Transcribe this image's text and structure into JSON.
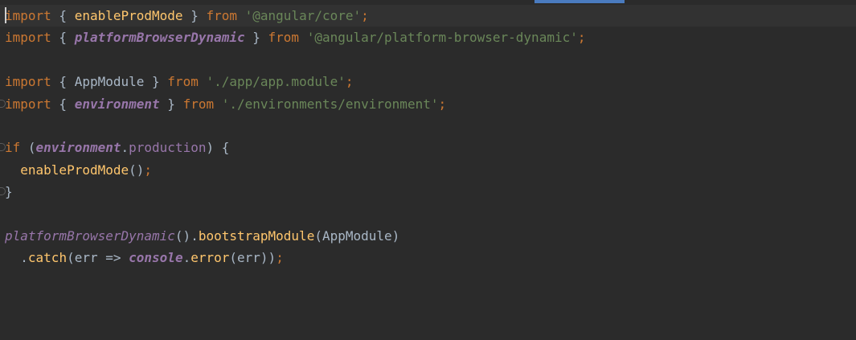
{
  "editor": {
    "lines": [
      [
        {
          "t": "import",
          "c": "kw"
        },
        {
          "t": " { ",
          "c": "plain"
        },
        {
          "t": "enableProdMode",
          "c": "fn"
        },
        {
          "t": " } ",
          "c": "plain"
        },
        {
          "t": "from",
          "c": "kw"
        },
        {
          "t": " ",
          "c": "plain"
        },
        {
          "t": "'@angular/core'",
          "c": "str"
        },
        {
          "t": ";",
          "c": "kw"
        }
      ],
      [
        {
          "t": "import",
          "c": "kw"
        },
        {
          "t": " { ",
          "c": "plain"
        },
        {
          "t": "platformBrowserDynamic",
          "c": "ital"
        },
        {
          "t": " } ",
          "c": "plain"
        },
        {
          "t": "from",
          "c": "kw"
        },
        {
          "t": " ",
          "c": "plain"
        },
        {
          "t": "'@angular/platform-browser-dynamic'",
          "c": "str"
        },
        {
          "t": ";",
          "c": "kw"
        }
      ],
      [],
      [
        {
          "t": "import",
          "c": "kw"
        },
        {
          "t": " { AppModule } ",
          "c": "plain"
        },
        {
          "t": "from",
          "c": "kw"
        },
        {
          "t": " ",
          "c": "plain"
        },
        {
          "t": "'./app/app.module'",
          "c": "str"
        },
        {
          "t": ";",
          "c": "kw"
        }
      ],
      [
        {
          "t": "import",
          "c": "kw"
        },
        {
          "t": " { ",
          "c": "plain"
        },
        {
          "t": "environment",
          "c": "ital"
        },
        {
          "t": " } ",
          "c": "plain"
        },
        {
          "t": "from",
          "c": "kw"
        },
        {
          "t": " ",
          "c": "plain"
        },
        {
          "t": "'./environments/environment'",
          "c": "str"
        },
        {
          "t": ";",
          "c": "kw"
        }
      ],
      [],
      [
        {
          "t": "if",
          "c": "kw"
        },
        {
          "t": " (",
          "c": "plain"
        },
        {
          "t": "environment",
          "c": "ital"
        },
        {
          "t": ".",
          "c": "plain"
        },
        {
          "t": "production",
          "c": "prop"
        },
        {
          "t": ") {",
          "c": "plain"
        }
      ],
      [
        {
          "t": "  ",
          "c": "plain"
        },
        {
          "t": "enableProdMode",
          "c": "fn"
        },
        {
          "t": "()",
          "c": "plain"
        },
        {
          "t": ";",
          "c": "kw"
        }
      ],
      [
        {
          "t": "}",
          "c": "plain"
        }
      ],
      [],
      [
        {
          "t": "platformBrowserDynamic",
          "c": "itfn"
        },
        {
          "t": "().",
          "c": "plain"
        },
        {
          "t": "bootstrapModule",
          "c": "fn"
        },
        {
          "t": "(AppModule)",
          "c": "plain"
        }
      ],
      [
        {
          "t": "  .",
          "c": "plain"
        },
        {
          "t": "catch",
          "c": "fn"
        },
        {
          "t": "(err => ",
          "c": "plain"
        },
        {
          "t": "console",
          "c": "ital"
        },
        {
          "t": ".",
          "c": "plain"
        },
        {
          "t": "error",
          "c": "fn"
        },
        {
          "t": "(err))",
          "c": "plain"
        },
        {
          "t": ";",
          "c": "kw"
        }
      ]
    ],
    "fold_markers_on_lines": [
      4,
      6,
      8
    ]
  }
}
